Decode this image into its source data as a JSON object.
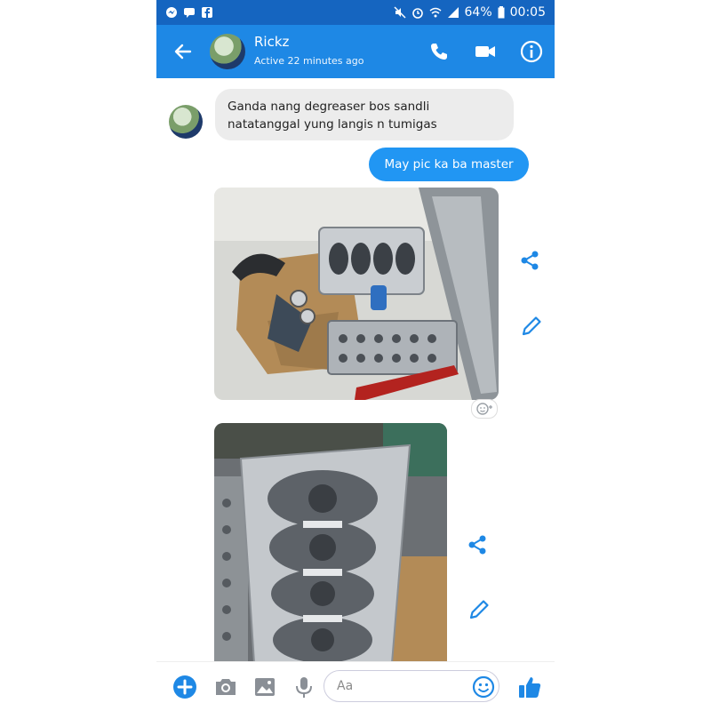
{
  "status_bar": {
    "battery": "64%",
    "time": "00:05"
  },
  "header": {
    "name": "Rickz",
    "status": "Active 22 minutes ago"
  },
  "messages": [
    {
      "line1": "Ganda nang degreaser bos sandli",
      "line2": "natatanggal yung langis n tumigas"
    },
    {
      "text": "May pic ka ba master"
    }
  ],
  "composer": {
    "placeholder": "Aa"
  },
  "colors": {
    "accent": "#1e88e5",
    "outgoing": "#2196f3",
    "incoming": "#ececec"
  }
}
